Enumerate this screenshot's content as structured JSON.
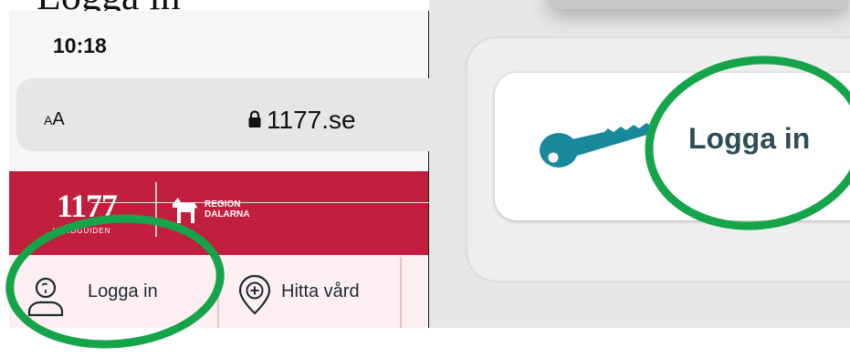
{
  "caption": {
    "partial_text": "Logga in"
  },
  "phone": {
    "status_time": "10:18",
    "address_bar": {
      "text_size_label": "AA",
      "lock_icon": "lock-icon",
      "url": "1177.se"
    },
    "brand": {
      "logo_number": "1177",
      "logo_subtitle": "VÅRDGUIDEN",
      "region_line1": "REGION",
      "region_line2": "DALARNA",
      "color": "#c21f3e"
    },
    "nav": {
      "items": [
        {
          "label": "Logga in",
          "icon": "person-icon"
        },
        {
          "label": "Hitta vård",
          "icon": "location-plus-icon"
        }
      ]
    }
  },
  "zoom": {
    "login_label": "Logga in",
    "key_icon": "key-icon",
    "key_color": "#18899a",
    "text_color": "#2e4d57"
  },
  "highlight_color": "#16a44a"
}
